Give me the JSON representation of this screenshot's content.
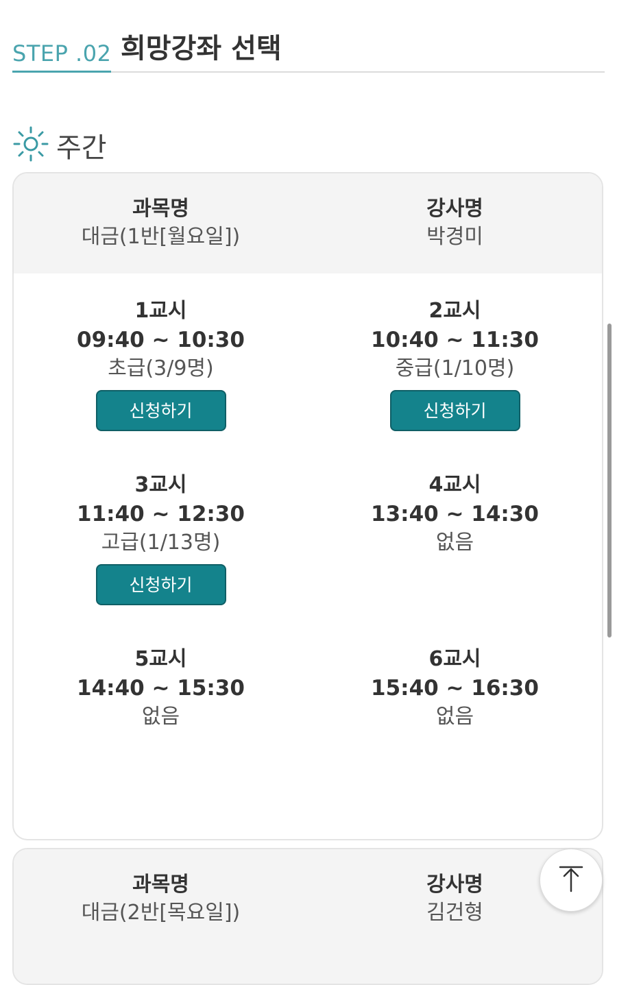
{
  "header": {
    "step_label": "STEP .02",
    "title": "희망강좌 선택"
  },
  "section": {
    "icon": "sun-icon",
    "title": "주간"
  },
  "courses": [
    {
      "subject_label": "과목명",
      "subject": "대금(1반[월요일])",
      "instructor_label": "강사명",
      "instructor": "박경미",
      "periods": [
        {
          "name": "1교시",
          "time": "09:40 ~ 10:30",
          "status": "초급(3/9명)",
          "button": "신청하기"
        },
        {
          "name": "2교시",
          "time": "10:40 ~ 11:30",
          "status": "중급(1/10명)",
          "button": "신청하기"
        },
        {
          "name": "3교시",
          "time": "11:40 ~ 12:30",
          "status": "고급(1/13명)",
          "button": "신청하기"
        },
        {
          "name": "4교시",
          "time": "13:40 ~ 14:30",
          "status": "없음"
        },
        {
          "name": "5교시",
          "time": "14:40 ~ 15:30",
          "status": "없음"
        },
        {
          "name": "6교시",
          "time": "15:40 ~ 16:30",
          "status": "없음"
        }
      ]
    },
    {
      "subject_label": "과목명",
      "subject": "대금(2반[목요일])",
      "instructor_label": "강사명",
      "instructor": "김건형"
    }
  ],
  "colors": {
    "accent": "#4aa4ae",
    "button": "#14838c"
  },
  "scroll_top_icon": "arrow-up-icon"
}
